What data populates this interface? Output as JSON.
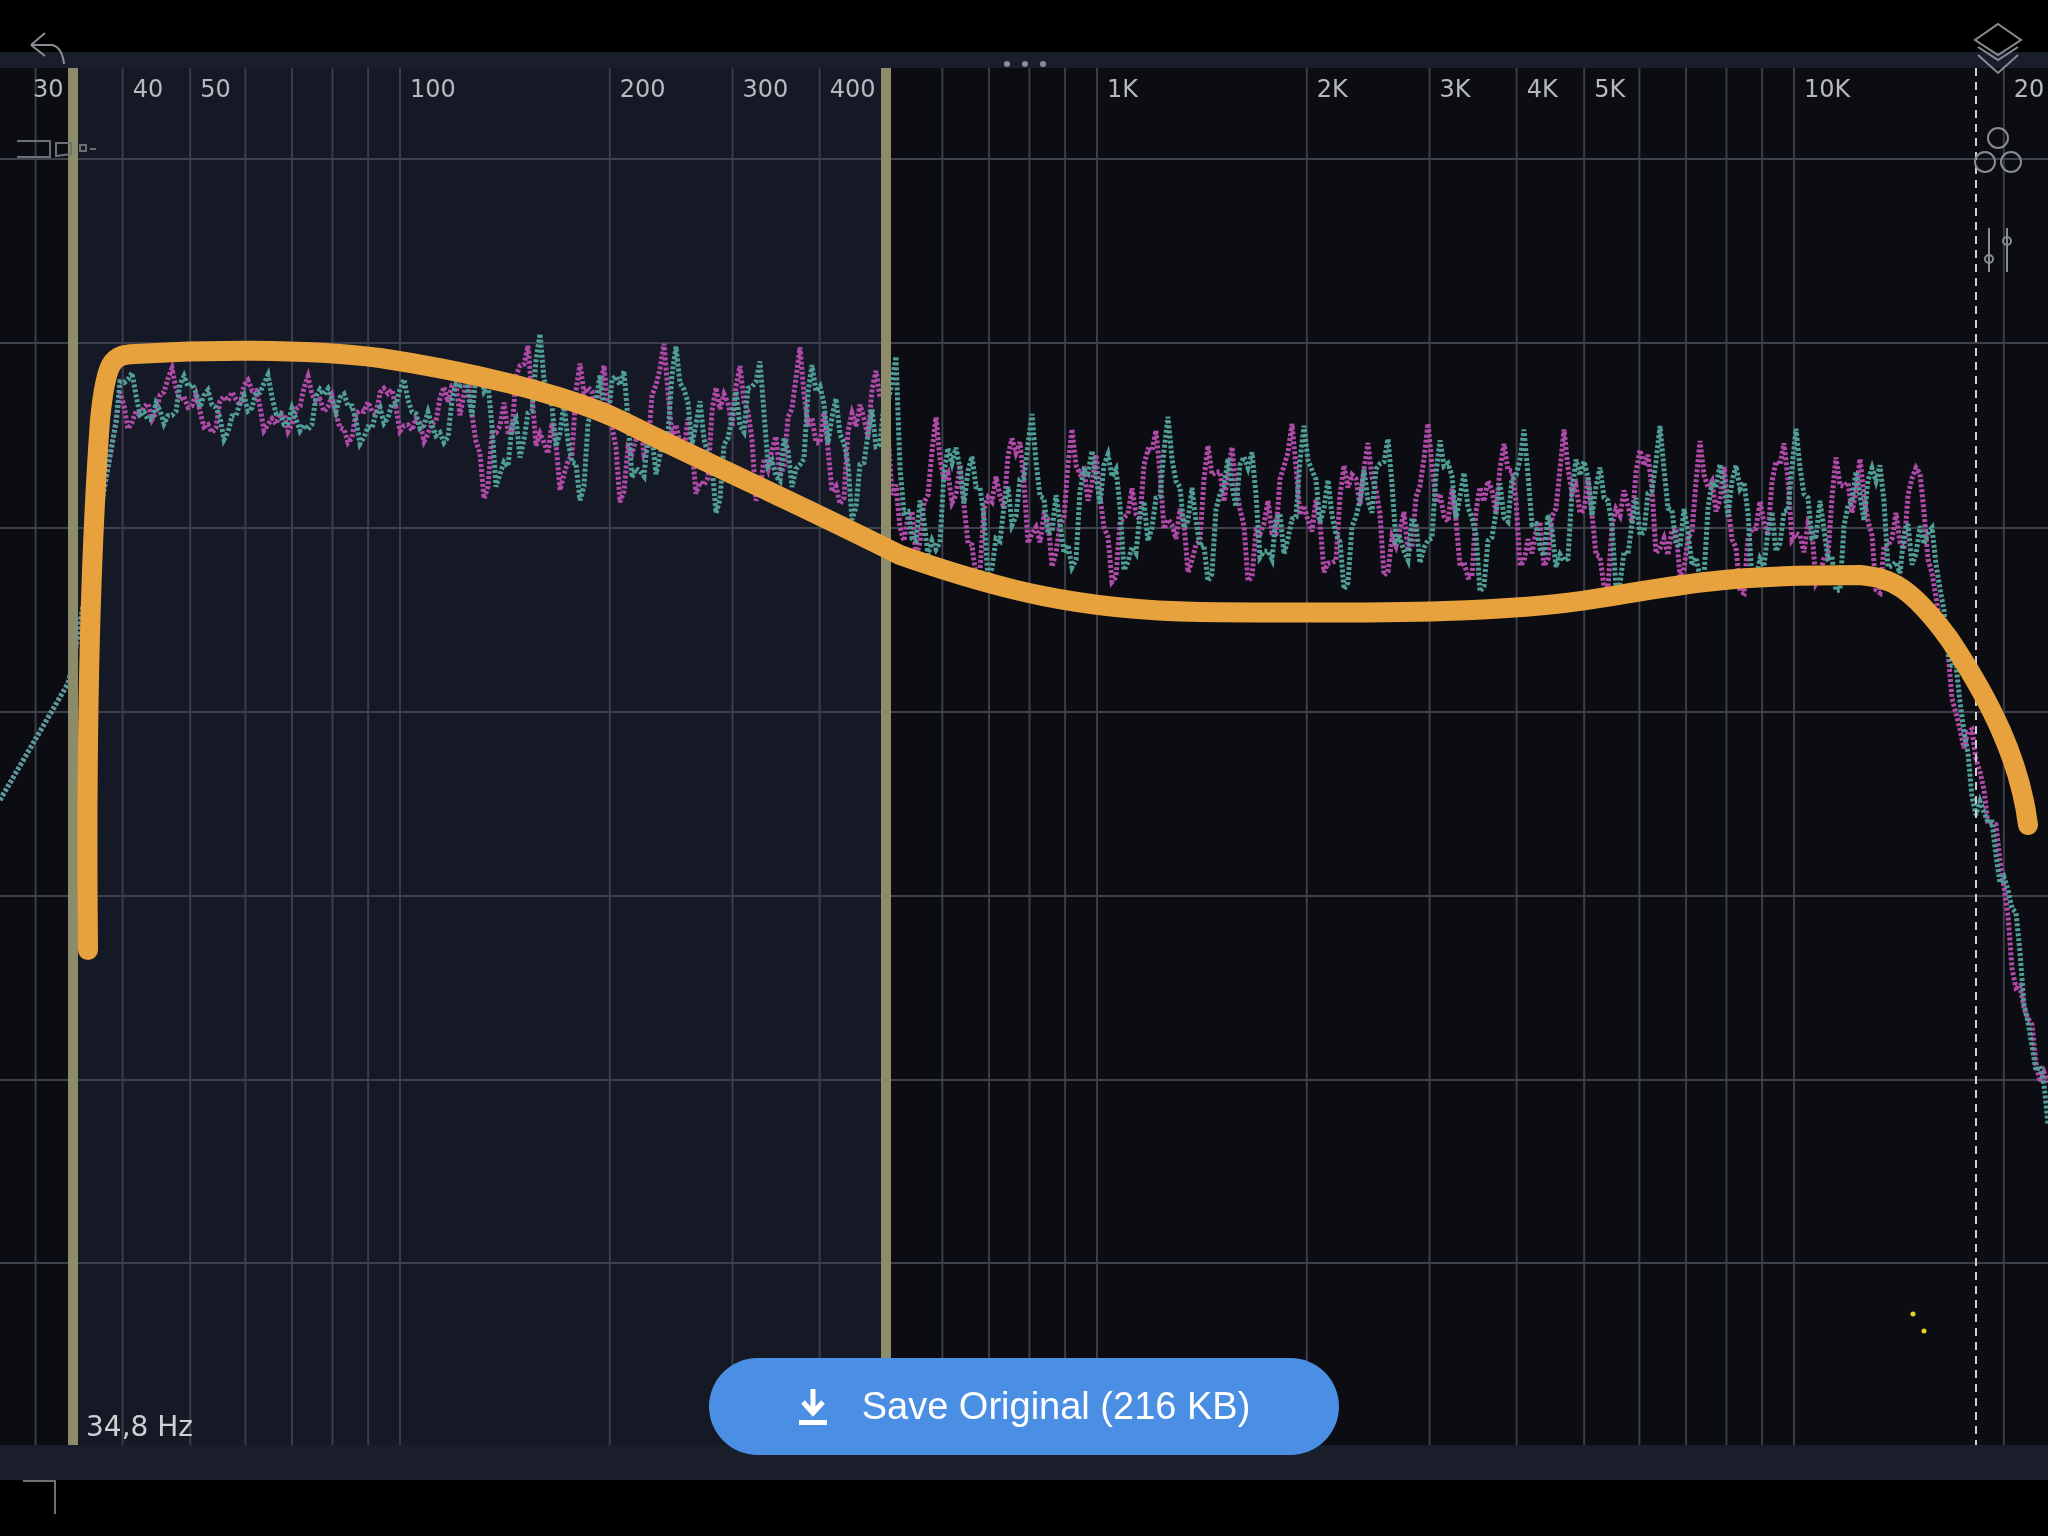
{
  "axis": {
    "frequency_labels": [
      "30",
      "40",
      "50",
      "100",
      "200",
      "300",
      "400",
      "1K",
      "2K",
      "3K",
      "4K",
      "5K",
      "10K",
      "20"
    ]
  },
  "cursor": {
    "readout": "34,8 Hz"
  },
  "save_button": {
    "label": "Save Original (216 KB)"
  }
}
